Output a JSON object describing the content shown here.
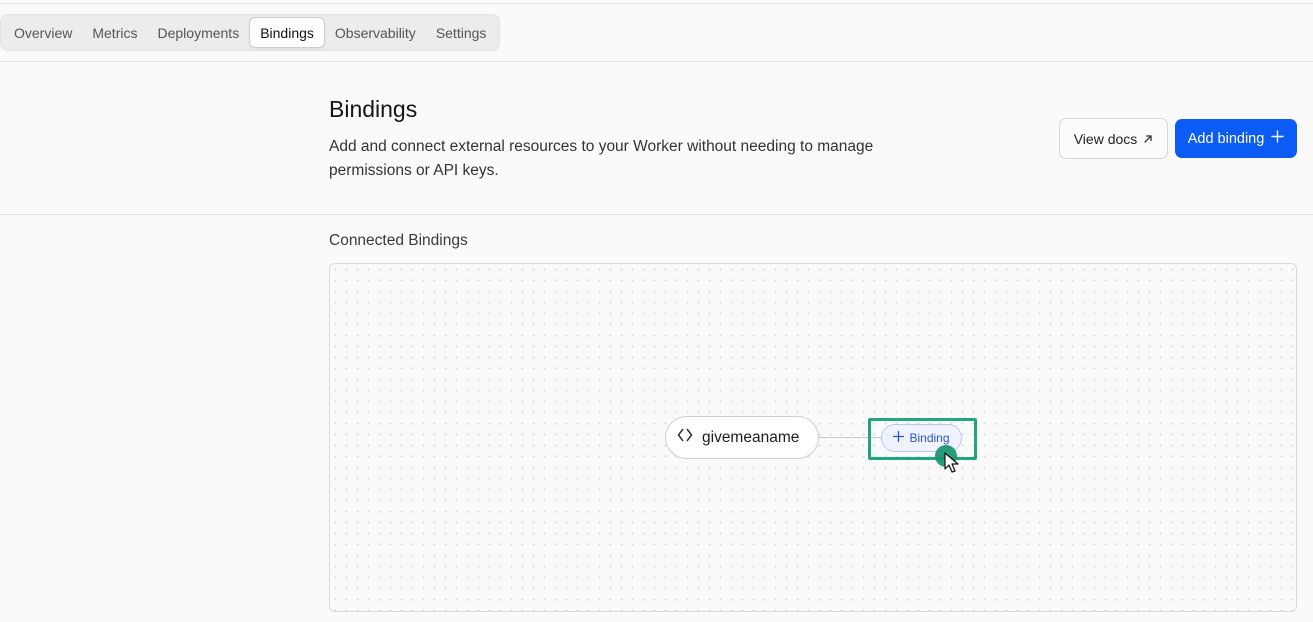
{
  "tabs": [
    {
      "label": "Overview"
    },
    {
      "label": "Metrics"
    },
    {
      "label": "Deployments"
    },
    {
      "label": "Bindings",
      "active": true
    },
    {
      "label": "Observability"
    },
    {
      "label": "Settings"
    }
  ],
  "header": {
    "title": "Bindings",
    "description": "Add and connect external resources to your Worker without needing to manage permissions or API keys."
  },
  "actions": {
    "view_docs_label": "View docs",
    "view_docs_icon": "external-arrow-icon",
    "add_binding_label": "Add binding",
    "add_binding_icon": "plus-icon"
  },
  "connected": {
    "section_label": "Connected Bindings",
    "worker_name": "givemeaname",
    "worker_icon": "code-brackets-icon",
    "add_pill_label": "Binding",
    "add_pill_icon": "plus-icon"
  },
  "colors": {
    "accent": "#0b5cf5",
    "highlight": "#1fa67f",
    "pill_text": "#2b55c9"
  }
}
